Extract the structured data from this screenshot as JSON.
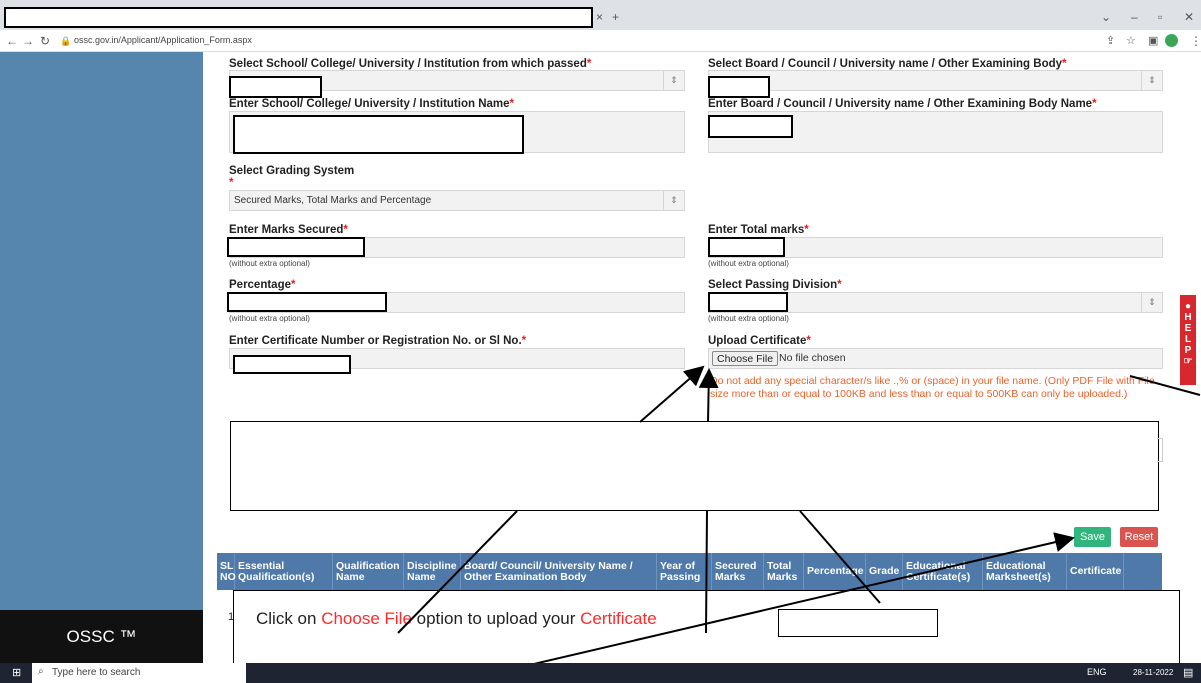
{
  "browser": {
    "address_url": "ossc.gov.in/Applicant/Application_Form.aspx",
    "tab_close": "×",
    "new_tab": "+"
  },
  "form": {
    "school_select": {
      "label": "Select School/ College/ University / Institution from which passed"
    },
    "board_select": {
      "label": "Select Board / Council / University name / Other Examining Body"
    },
    "school_name": {
      "label": "Enter School/ College/ University / Institution Name"
    },
    "board_name": {
      "label": "Enter Board / Council / University name / Other Examining Body Name"
    },
    "grading": {
      "label": "Select Grading System",
      "value": "Secured Marks, Total Marks and Percentage"
    },
    "marks_secured": {
      "label": "Enter Marks Secured",
      "hint": "(without extra optional)"
    },
    "total_marks": {
      "label": "Enter Total marks",
      "hint": "(without extra optional)"
    },
    "percentage": {
      "label": "Percentage",
      "hint": "(without extra optional)"
    },
    "passing_division": {
      "label": "Select Passing Division",
      "hint": "(without extra optional)"
    },
    "certificate_no": {
      "label": "Enter Certificate Number or Registration No. or Sl No."
    },
    "upload": {
      "label": "Upload Certificate",
      "choose_file": "Choose File",
      "no_file": "No file chosen",
      "note": "Do not add any special character/s like .,% or (space) in your file name. (Only PDF File with File size more than or equal to 100KB and less than or equal to 500KB can only be uploaded.)"
    },
    "required_mark": "*",
    "save_label": "Save",
    "reset_label": "Reset"
  },
  "table": {
    "headers": [
      "SL NO",
      "Essential Qualification(s)",
      "Qualification Name",
      "Discipline Name",
      "Board/ Council/ University Name / Other Examination Body",
      "Year of Passing",
      "Secured Marks",
      "Total Marks",
      "Percentage",
      "Grade",
      "Educational Certificate(s)",
      "Educational Marksheet(s)",
      "Certificate"
    ],
    "row_no": "1"
  },
  "sidebar": {
    "brand": "OSSC ™"
  },
  "help": {
    "letters": [
      "H",
      "E",
      "L",
      "P"
    ]
  },
  "callout": {
    "prefix": "Click on ",
    "highlight1": "Choose File",
    "middle": " option to upload your ",
    "highlight2": "Certificate"
  },
  "taskbar": {
    "search_placeholder": "Type here to search",
    "lang": "ENG",
    "date": "28-11-2022"
  },
  "colors": {
    "sidebar": "#5686ae",
    "table_header": "#4f79a8",
    "save": "#2fb57d",
    "reset": "#d9534f",
    "callout_red": "#ff2a2a",
    "note": "#e8632c"
  }
}
